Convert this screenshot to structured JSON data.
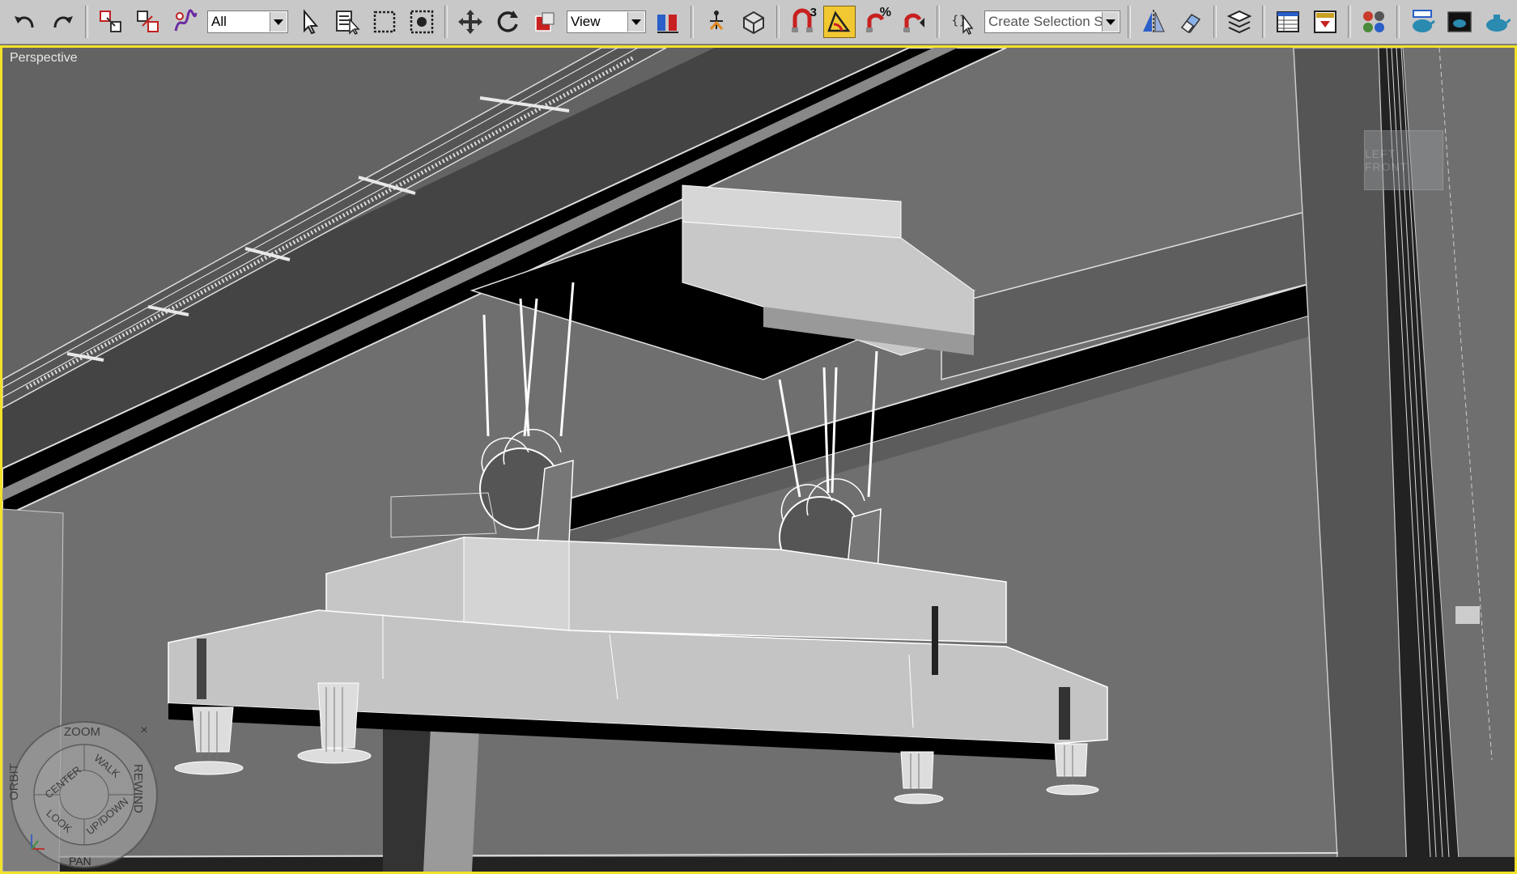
{
  "toolbar": {
    "selection_filter": "All",
    "reference_coord": "View",
    "named_selection_placeholder": "Create Selection Set",
    "angle_snap_label": "3",
    "percent_snap_label": "%"
  },
  "viewport": {
    "label": "Perspective",
    "viewcube_label": "LEFT FRONT"
  },
  "steering_wheel": {
    "zoom": "ZOOM",
    "orbit": "ORBIT",
    "rewind": "REWIND",
    "center": "CENTER",
    "walk": "WALK",
    "look": "LOOK",
    "updown": "UP/DOWN",
    "pan": "PAN",
    "close": "×"
  },
  "colors": {
    "toolbar_bg": "#c8c8c8",
    "viewport_border": "#f2e22a",
    "active_tool": "#f2c832"
  }
}
